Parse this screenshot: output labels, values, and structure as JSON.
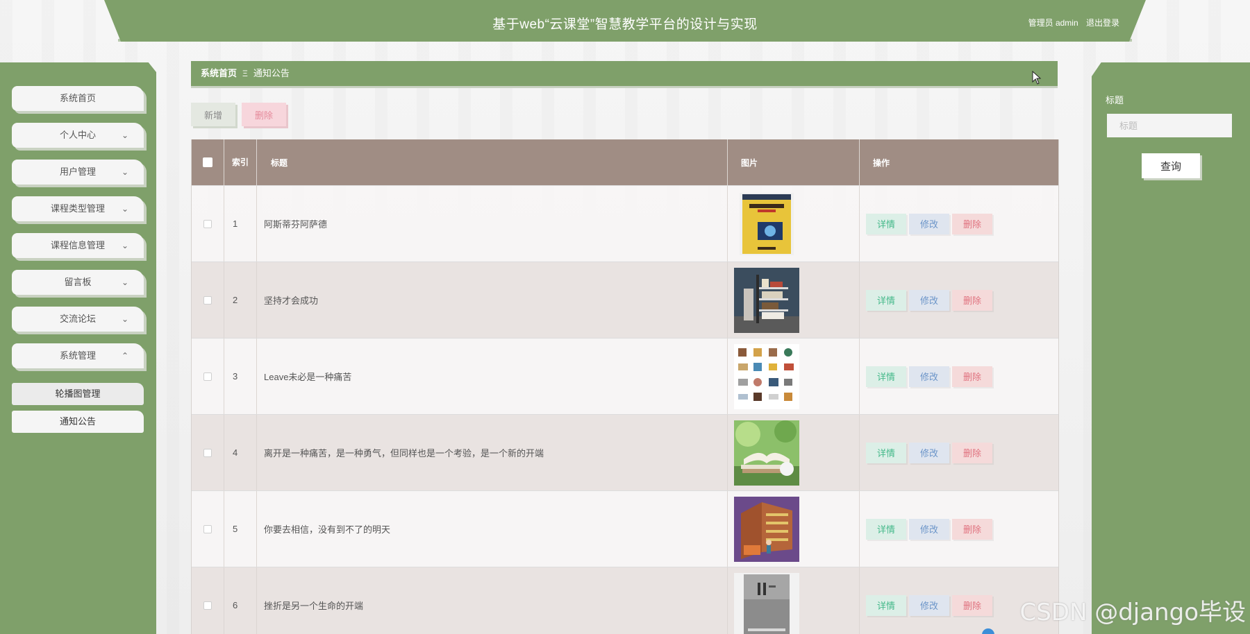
{
  "header": {
    "title": "基于web“云课堂”智慧教学平台的设计与实现",
    "user_label": "管理员 admin",
    "logout_label": "退出登录"
  },
  "sidebar": {
    "items": [
      {
        "label": "系统首页",
        "has_chevron": false
      },
      {
        "label": "个人中心",
        "chevron": "⌄"
      },
      {
        "label": "用户管理",
        "chevron": "⌄"
      },
      {
        "label": "课程类型管理",
        "chevron": "⌄"
      },
      {
        "label": "课程信息管理",
        "chevron": "⌄"
      },
      {
        "label": "留言板",
        "chevron": "⌄"
      },
      {
        "label": "交流论坛",
        "chevron": "⌄"
      },
      {
        "label": "系统管理",
        "chevron": "⌃"
      }
    ],
    "sub_items": [
      {
        "label": "轮播图管理"
      },
      {
        "label": "通知公告"
      }
    ]
  },
  "breadcrumb": {
    "home": "系统首页",
    "separator": "Ξ",
    "current": "通知公告"
  },
  "toolbar": {
    "add_label": "新增",
    "delete_label": "删除"
  },
  "table": {
    "headers": {
      "index": "索引",
      "title": "标题",
      "image": "图片",
      "ops": "操作"
    },
    "rows": [
      {
        "index": "1",
        "title": "阿斯蒂芬阿萨德",
        "image_icon": "book-cover-ecommerce-security"
      },
      {
        "index": "2",
        "title": "坚持才会成功",
        "image_icon": "bookshelf-photo"
      },
      {
        "index": "3",
        "title": "Leave未必是一种痛苦",
        "image_icon": "library-icons-grid"
      },
      {
        "index": "4",
        "title": "离开是一种痛苦，是一种勇气，但同样也是一个考验，是一个新的开端",
        "image_icon": "open-book-on-grass"
      },
      {
        "index": "5",
        "title": "你要去相信，没有到不了的明天",
        "image_icon": "library-illustration"
      },
      {
        "index": "6",
        "title": "挫折是另一个生命的开端",
        "image_icon": "gray-book-cover"
      }
    ],
    "op_labels": {
      "detail": "详情",
      "edit": "修改",
      "delete": "删除"
    }
  },
  "search": {
    "label": "标题",
    "placeholder": "标题",
    "button_label": "查询"
  },
  "watermark": "CSDN @django毕设",
  "colors": {
    "theme_green": "#7fa06a",
    "table_header": "#a08d84",
    "detail": "#45b98a",
    "edit": "#6c95c9",
    "delete": "#e0727f"
  }
}
